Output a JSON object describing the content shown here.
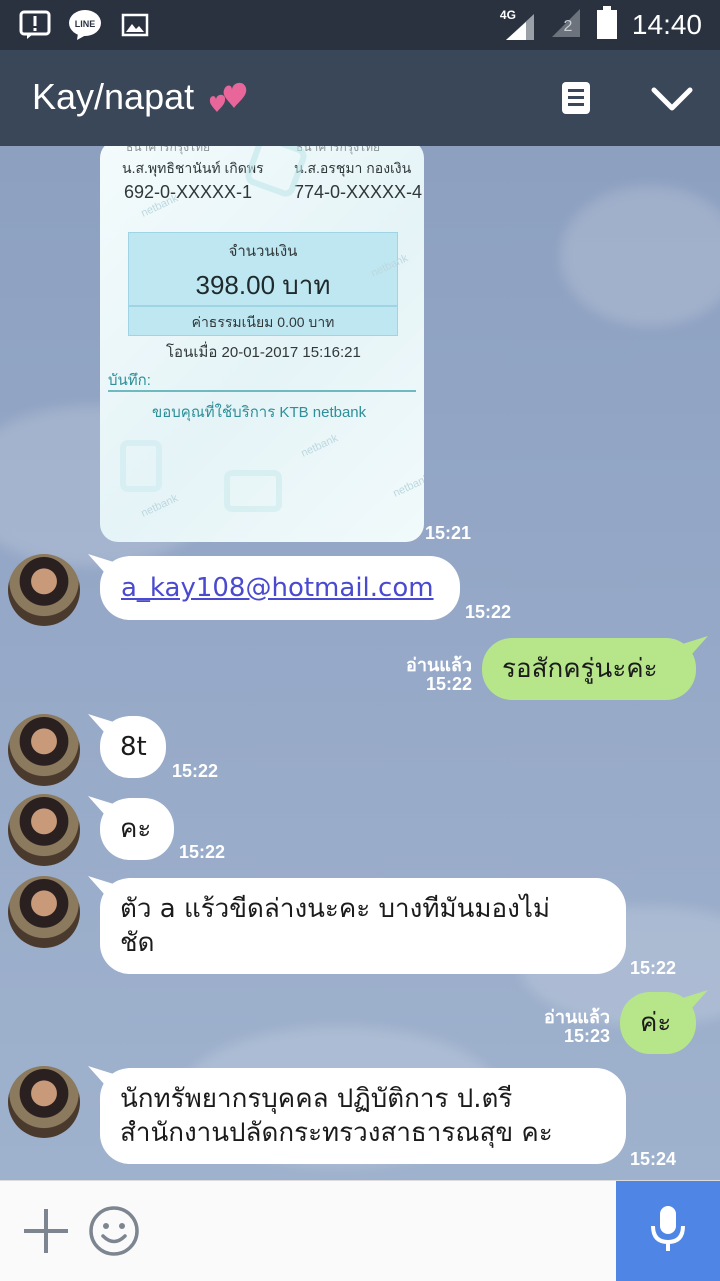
{
  "status_bar": {
    "network": "4G",
    "time": "14:40"
  },
  "header": {
    "title": "Kay/napat"
  },
  "slip": {
    "sender_bank": "ธนาคารกรุงไทย",
    "receiver_bank": "ธนาคารกรุงไทย",
    "sender_name": "น.ส.พุทธิชานันท์ เกิดพร",
    "receiver_name": "น.ส.อรชุมา กองเงิน",
    "sender_acct": "692-0-XXXXX-1",
    "receiver_acct": "774-0-XXXXX-4",
    "amount_label": "จำนวนเงิน",
    "amount": "398.00 บาท",
    "fee": "ค่าธรรมเนียม 0.00 บาท",
    "datetime": "โอนเมื่อ 20-01-2017 15:16:21",
    "memo_label": "บันทึก:",
    "thanks": "ขอบคุณที่ใช้บริการ KTB netbank",
    "watermark": "netbank"
  },
  "messages": {
    "m0": {
      "time": "15:21"
    },
    "m1": {
      "text": "a_kay108@hotmail.com",
      "time": "15:22"
    },
    "m2": {
      "text": "รอสักครู่นะค่ะ",
      "read": "อ่านแล้ว",
      "time": "15:22"
    },
    "m3": {
      "text": "8t",
      "time": "15:22"
    },
    "m4": {
      "text": "คะ",
      "time": "15:22"
    },
    "m5": {
      "line1": "ตัว a แร้วขีดล่างนะคะ บางทีมันมองไม่",
      "line2": "ชัด",
      "time": "15:22"
    },
    "m6": {
      "text": "ค่ะ",
      "read": "อ่านแล้ว",
      "time": "15:23"
    },
    "m7": {
      "line1": "นักทรัพยากรบุคคล ปฏิบัติการ ป.ตรี",
      "line2": "สำนักงานปลัดกระทรวงสาธารณสุข คะ",
      "time": "15:24"
    }
  },
  "icons": {
    "status": [
      "alert-icon",
      "line-app-icon",
      "image-icon",
      "signal-icon",
      "sim-icon",
      "battery-icon"
    ],
    "header": [
      "notes-icon",
      "chevron-down-icon"
    ],
    "input": [
      "plus-icon",
      "emoji-icon",
      "mic-icon"
    ]
  }
}
